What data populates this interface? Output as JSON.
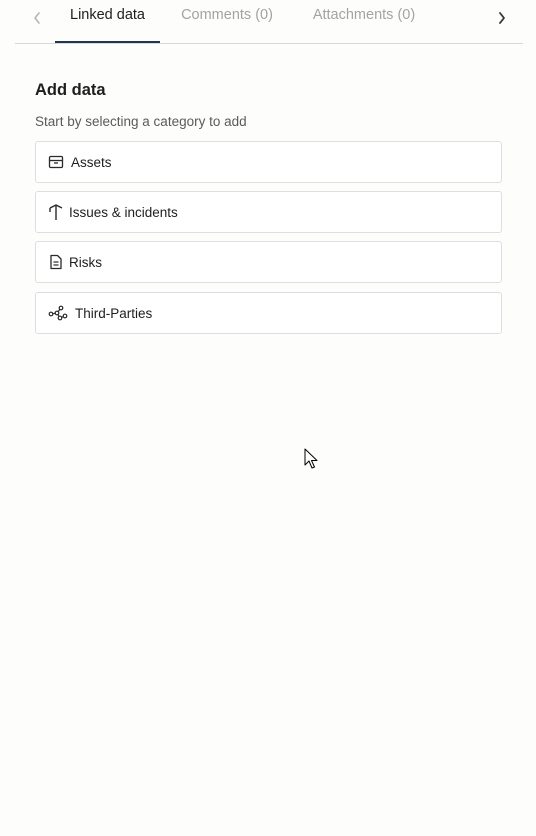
{
  "tabs": {
    "items": [
      {
        "label": "Linked data",
        "active": true
      },
      {
        "label": "Comments (0)",
        "active": false
      },
      {
        "label": "Attachments (0)",
        "active": false
      }
    ],
    "prev_icon": "chevron-left-icon",
    "next_icon": "chevron-right-icon"
  },
  "section": {
    "title": "Add data",
    "subtitle": "Start by selecting a category to add"
  },
  "categories": [
    {
      "label": "Assets",
      "icon": "box-icon"
    },
    {
      "label": "Issues & incidents",
      "icon": "signpost-icon"
    },
    {
      "label": "Risks",
      "icon": "document-icon"
    },
    {
      "label": "Third-Parties",
      "icon": "network-icon"
    }
  ],
  "colors": {
    "active_tab_underline": "#1f3650",
    "inactive_tab_text": "#a3a3a3",
    "background": "#fdfdfb"
  }
}
